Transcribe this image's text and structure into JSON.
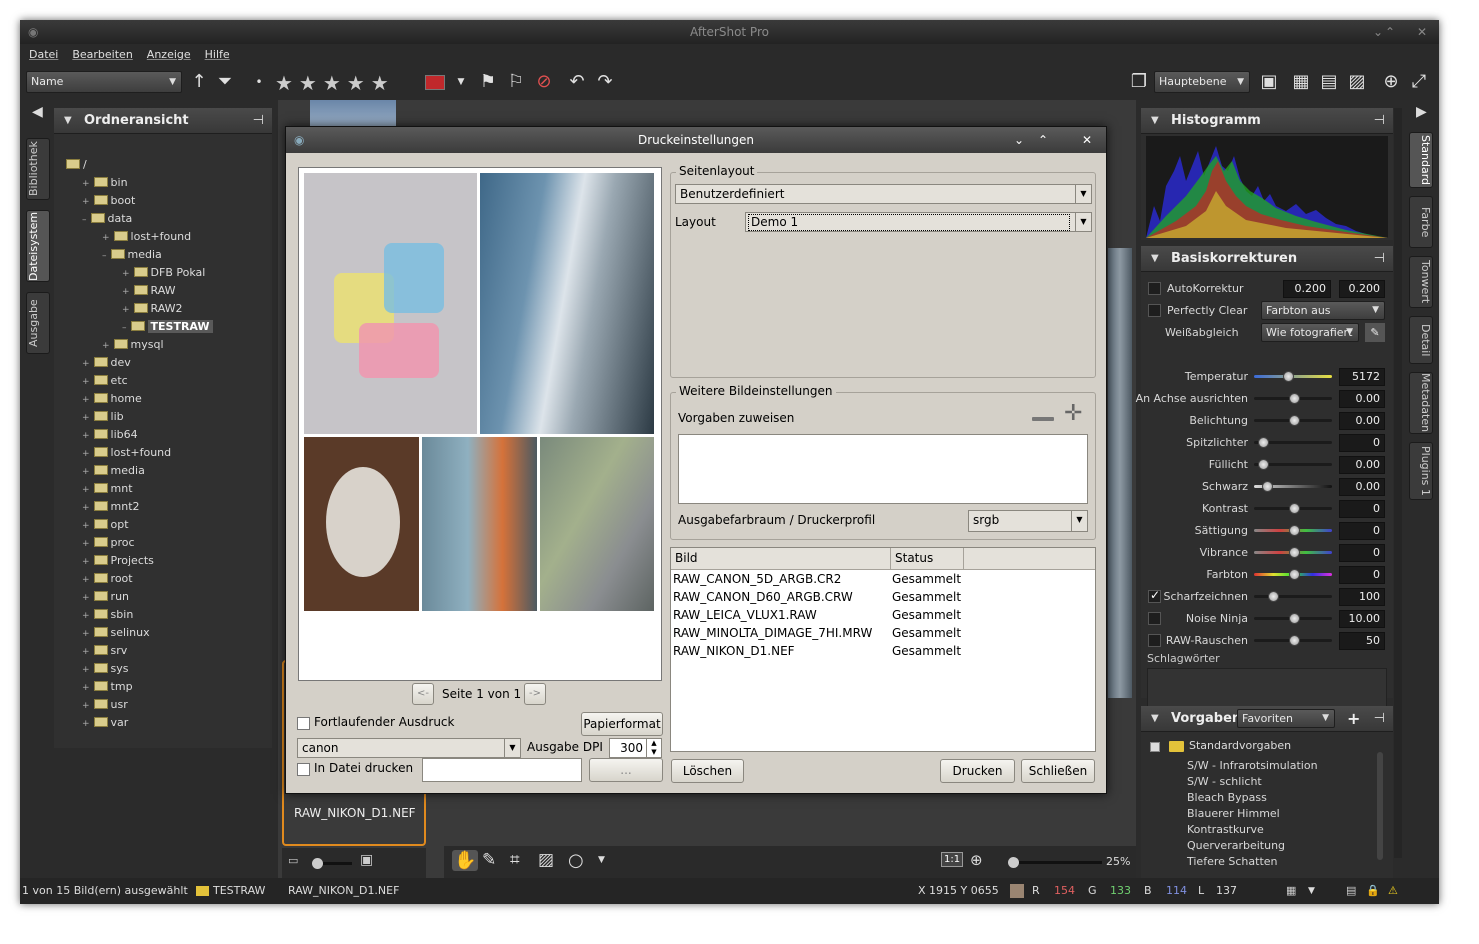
{
  "app": {
    "title": "AfterShot Pro"
  },
  "menu": [
    "Datei",
    "Bearbeiten",
    "Anzeige",
    "Hilfe"
  ],
  "toolbar": {
    "sort_value": "Name",
    "layer_value": "Hauptebene"
  },
  "left_tabs": [
    "Bibliothek",
    "Dateisystem",
    "Ausgabe"
  ],
  "right_tabs": [
    "Standard",
    "Farbe",
    "Tonwert",
    "Detail",
    "Metadaten",
    "Plugins 1"
  ],
  "folder_panel": {
    "title": "Ordneransicht"
  },
  "tree": [
    {
      "label": "/",
      "level": 0,
      "exp": ""
    },
    {
      "label": "bin",
      "level": 1,
      "exp": "+"
    },
    {
      "label": "boot",
      "level": 1,
      "exp": "+"
    },
    {
      "label": "data",
      "level": 1,
      "exp": "–"
    },
    {
      "label": "lost+found",
      "level": 2,
      "exp": "+"
    },
    {
      "label": "media",
      "level": 2,
      "exp": "–"
    },
    {
      "label": "DFB Pokal",
      "level": 3,
      "exp": "+"
    },
    {
      "label": "RAW",
      "level": 3,
      "exp": "+"
    },
    {
      "label": "RAW2",
      "level": 3,
      "exp": "+"
    },
    {
      "label": "TESTRAW",
      "level": 3,
      "exp": "–",
      "selected": true
    },
    {
      "label": "mysql",
      "level": 2,
      "exp": "+"
    },
    {
      "label": "dev",
      "level": 1,
      "exp": "+"
    },
    {
      "label": "etc",
      "level": 1,
      "exp": "+"
    },
    {
      "label": "home",
      "level": 1,
      "exp": "+"
    },
    {
      "label": "lib",
      "level": 1,
      "exp": "+"
    },
    {
      "label": "lib64",
      "level": 1,
      "exp": "+"
    },
    {
      "label": "lost+found",
      "level": 1,
      "exp": "+"
    },
    {
      "label": "media",
      "level": 1,
      "exp": "+"
    },
    {
      "label": "mnt",
      "level": 1,
      "exp": "+"
    },
    {
      "label": "mnt2",
      "level": 1,
      "exp": "+"
    },
    {
      "label": "opt",
      "level": 1,
      "exp": "+"
    },
    {
      "label": "proc",
      "level": 1,
      "exp": "+"
    },
    {
      "label": "Projects",
      "level": 1,
      "exp": "+"
    },
    {
      "label": "root",
      "level": 1,
      "exp": "+"
    },
    {
      "label": "run",
      "level": 1,
      "exp": "+"
    },
    {
      "label": "sbin",
      "level": 1,
      "exp": "+"
    },
    {
      "label": "selinux",
      "level": 1,
      "exp": "+"
    },
    {
      "label": "srv",
      "level": 1,
      "exp": "+"
    },
    {
      "label": "sys",
      "level": 1,
      "exp": "+"
    },
    {
      "label": "tmp",
      "level": 1,
      "exp": "+"
    },
    {
      "label": "usr",
      "level": 1,
      "exp": "+"
    },
    {
      "label": "var",
      "level": 1,
      "exp": "+"
    }
  ],
  "thumb": {
    "label": "RAW_NIKON_D1.NEF"
  },
  "zoom": {
    "value": "25%",
    "one_to_one": "1:1"
  },
  "dialog": {
    "title": "Druckeinstellungen",
    "page_nav": {
      "prev": "<-",
      "label": "Seite 1 von 1",
      "next": "->"
    },
    "continuous": "Fortlaufender Ausdruck",
    "paper_btn": "Papierformat",
    "printer": "canon",
    "dpi_label": "Ausgabe DPI",
    "dpi": "300",
    "to_file": "In Datei drucken",
    "browse_btn": "...",
    "layout_group": "Seitenlayout",
    "layout_preset": "Benutzerdefiniert",
    "layout_label": "Layout",
    "layout_value": "Demo 1",
    "more_group": "Weitere Bildeinstellungen",
    "presets_label": "Vorgaben zuweisen",
    "colorspace_label": "Ausgabefarbraum / Druckerprofil",
    "colorspace_value": "srgb",
    "table_headers": [
      "Bild",
      "Status"
    ],
    "rows": [
      {
        "file": "RAW_CANON_5D_ARGB.CR2",
        "status": "Gesammelt"
      },
      {
        "file": "RAW_CANON_D60_ARGB.CRW",
        "status": "Gesammelt"
      },
      {
        "file": "RAW_LEICA_VLUX1.RAW",
        "status": "Gesammelt"
      },
      {
        "file": "RAW_MINOLTA_DIMAGE_7HI.MRW",
        "status": "Gesammelt"
      },
      {
        "file": "RAW_NIKON_D1.NEF",
        "status": "Gesammelt"
      }
    ],
    "delete_btn": "Löschen",
    "print_btn": "Drucken",
    "close_btn": "Schließen"
  },
  "histogram": {
    "title": "Histogramm"
  },
  "basic": {
    "title": "Basiskorrekturen",
    "auto_label": "AutoKorrektur",
    "auto_v1": "0.200",
    "auto_v2": "0.200",
    "perfect_label": "Perfectly Clear",
    "perfect_value": "Farbton aus",
    "wb_label": "Weißabgleich",
    "wb_value": "Wie fotografiert",
    "sliders": [
      {
        "label": "Temperatur",
        "value": "5172",
        "pos": 0.42
      },
      {
        "label": "An Achse ausrichten",
        "value": "0.00",
        "pos": 0.5
      },
      {
        "label": "Belichtung",
        "value": "0.00",
        "pos": 0.5
      },
      {
        "label": "Spitzlichter",
        "value": "0",
        "pos": 0.05
      },
      {
        "label": "Füllicht",
        "value": "0.00",
        "pos": 0.05
      },
      {
        "label": "Schwarz",
        "value": "0.00",
        "pos": 0.12
      },
      {
        "label": "Kontrast",
        "value": "0",
        "pos": 0.5
      },
      {
        "label": "Sättigung",
        "value": "0",
        "pos": 0.5
      },
      {
        "label": "Vibrance",
        "value": "0",
        "pos": 0.5
      },
      {
        "label": "Farbton",
        "value": "0",
        "pos": 0.5
      },
      {
        "label": "Scharfzeichnen",
        "value": "100",
        "pos": 0.2
      },
      {
        "label": "Noise Ninja",
        "value": "10.00",
        "pos": 0.5
      },
      {
        "label": "RAW-Rauschen",
        "value": "50",
        "pos": 0.5
      }
    ],
    "keywords": "Schlagwörter"
  },
  "presets": {
    "title": "Vorgaben",
    "filter": "Favoriten",
    "root": "Standardvorgaben",
    "items": [
      "S/W - Infrarotsimulation",
      "S/W - schlicht",
      "Bleach Bypass",
      "Blauerer Himmel",
      "Kontrastkurve",
      "Querverarbeitung",
      "Tiefere Schatten"
    ]
  },
  "status": {
    "selection": "1 von 15 Bild(ern) ausgewählt",
    "folder": "TESTRAW",
    "file": "RAW_NIKON_D1.NEF",
    "coords": "X 1915  Y 0655",
    "r_label": "R",
    "r": "154",
    "g_label": "G",
    "g": "133",
    "b_label": "B",
    "b": "114",
    "l_label": "L",
    "l": "137"
  }
}
